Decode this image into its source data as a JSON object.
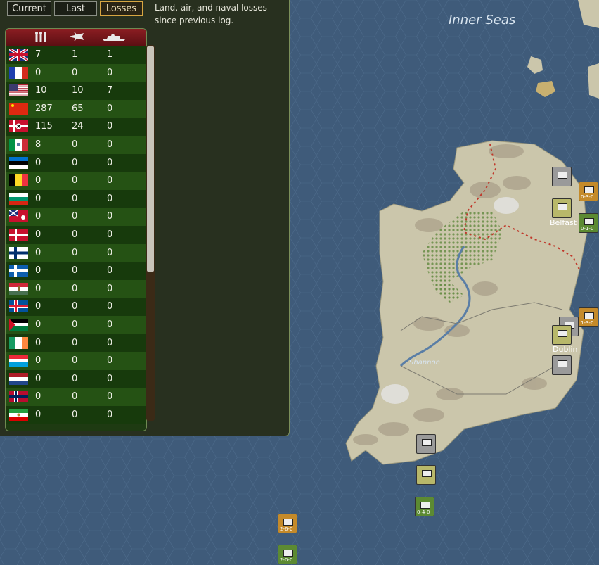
{
  "map": {
    "sea_label": "Inner Seas",
    "cities": [
      "Belfast",
      "Dublin"
    ],
    "river": "Shannon"
  },
  "tabs": [
    {
      "label": "Current",
      "active": false
    },
    {
      "label": "Last",
      "active": false
    },
    {
      "label": "Losses",
      "active": true
    }
  ],
  "description": "Land, air, and naval losses since previous log.",
  "columns": [
    "land-icon",
    "air-icon",
    "naval-icon"
  ],
  "rows": [
    {
      "flag": "united-kingdom",
      "land": "7",
      "air": "1",
      "naval": "1"
    },
    {
      "flag": "france",
      "land": "0",
      "air": "0",
      "naval": "0"
    },
    {
      "flag": "united-states",
      "land": "10",
      "air": "10",
      "naval": "7"
    },
    {
      "flag": "china",
      "land": "287",
      "air": "65",
      "naval": "0"
    },
    {
      "flag": "germany",
      "land": "115",
      "air": "24",
      "naval": "0"
    },
    {
      "flag": "italy",
      "land": "8",
      "air": "0",
      "naval": "0"
    },
    {
      "flag": "estonia",
      "land": "0",
      "air": "0",
      "naval": "0"
    },
    {
      "flag": "belgium",
      "land": "0",
      "air": "0",
      "naval": "0"
    },
    {
      "flag": "bulgaria",
      "land": "0",
      "air": "0",
      "naval": "0"
    },
    {
      "flag": "canada",
      "land": "0",
      "air": "0",
      "naval": "0"
    },
    {
      "flag": "denmark",
      "land": "0",
      "air": "0",
      "naval": "0"
    },
    {
      "flag": "finland",
      "land": "0",
      "air": "0",
      "naval": "0"
    },
    {
      "flag": "greece",
      "land": "0",
      "air": "0",
      "naval": "0"
    },
    {
      "flag": "hungary",
      "land": "0",
      "air": "0",
      "naval": "0"
    },
    {
      "flag": "iceland",
      "land": "0",
      "air": "0",
      "naval": "0"
    },
    {
      "flag": "iraq",
      "land": "0",
      "air": "0",
      "naval": "0"
    },
    {
      "flag": "ireland",
      "land": "0",
      "air": "0",
      "naval": "0"
    },
    {
      "flag": "luxembourg",
      "land": "0",
      "air": "0",
      "naval": "0"
    },
    {
      "flag": "netherlands",
      "land": "0",
      "air": "0",
      "naval": "0"
    },
    {
      "flag": "norway",
      "land": "0",
      "air": "0",
      "naval": "0"
    },
    {
      "flag": "persia",
      "land": "0",
      "air": "0",
      "naval": "0"
    }
  ],
  "units": [
    {
      "kind": "ground-counter",
      "color": "#9a9a9a",
      "label": ""
    },
    {
      "kind": "ground-counter",
      "color": "#b8b86a",
      "label": ""
    },
    {
      "kind": "naval-counter",
      "color": "#c48a2a",
      "label": "0-3-0"
    },
    {
      "kind": "naval-counter",
      "color": "#5c8a32",
      "label": "0-1-0"
    },
    {
      "kind": "naval-counter",
      "color": "#c48a2a",
      "label": "1-3-0"
    },
    {
      "kind": "air-counter",
      "color": "#9a9a9a",
      "label": ""
    },
    {
      "kind": "ground-counter",
      "color": "#b8b86a",
      "label": ""
    },
    {
      "kind": "ground-counter",
      "color": "#9a9a9a",
      "label": ""
    },
    {
      "kind": "ground-counter",
      "color": "#9a9a9a",
      "label": ""
    },
    {
      "kind": "ground-counter",
      "color": "#b8b86a",
      "label": ""
    },
    {
      "kind": "naval-counter",
      "color": "#5c8a32",
      "label": "0-4-0"
    },
    {
      "kind": "naval-counter",
      "color": "#c48a2a",
      "label": "2-6-0"
    },
    {
      "kind": "naval-counter",
      "color": "#5c8a32",
      "label": "2-0-0"
    }
  ]
}
